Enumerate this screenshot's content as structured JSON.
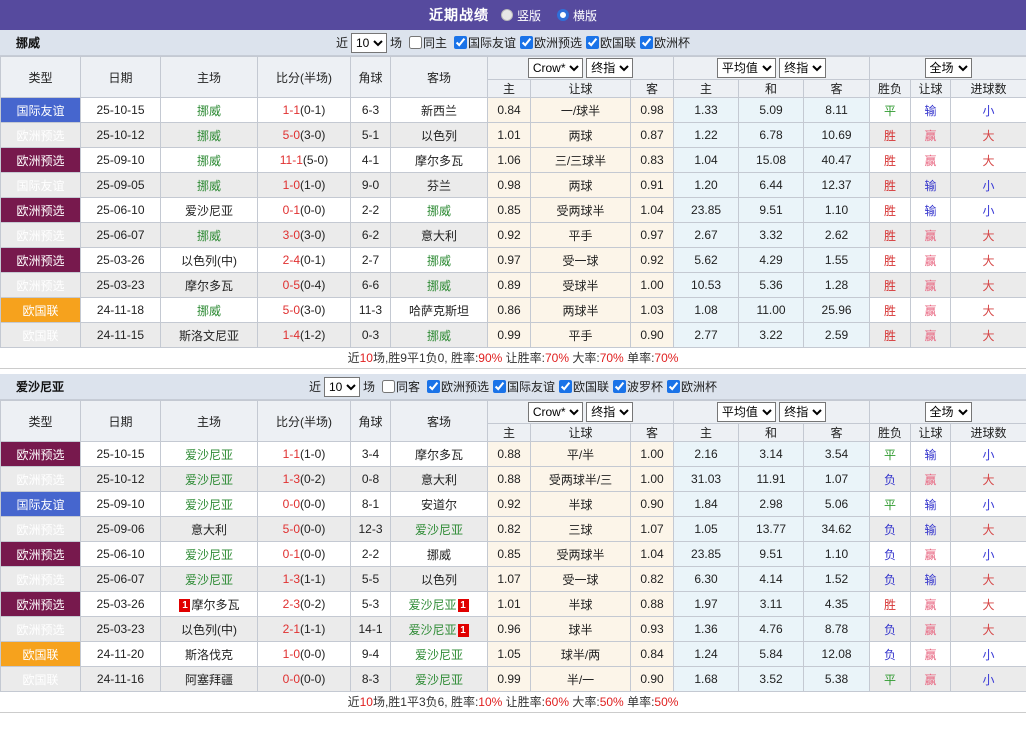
{
  "header": {
    "title": "近期战绩",
    "options": [
      {
        "label": "竖版",
        "selected": false
      },
      {
        "label": "横版",
        "selected": true
      }
    ]
  },
  "labels": {
    "near": "近",
    "count": "10",
    "games": "场"
  },
  "dropdowns": {
    "odds_source": "Crow*",
    "odds_final": "终指",
    "avg_source": "平均值",
    "avg_final": "终指",
    "result_scope": "全场"
  },
  "columns": {
    "type": "类型",
    "date": "日期",
    "home": "主场",
    "score": "比分(半场)",
    "corner": "角球",
    "away": "客场",
    "odds_home": "主",
    "handicap": "让球",
    "odds_away": "客",
    "avg_home": "主",
    "avg_draw": "和",
    "avg_away": "客",
    "wdl": "胜负",
    "handicap_result": "让球",
    "goals": "进球数"
  },
  "colors": {
    "header_bar": "#564A9E",
    "section_bar": "#DCE3ED",
    "badge_friendly": "#4666CE",
    "badge_qualifier": "#77194D",
    "badge_nations": "#F6A21D",
    "focus_team": "#2E8B35",
    "score_red": "#E03030",
    "win": "#D63333",
    "draw": "#2F9A2F",
    "lose": "#3333CC",
    "handicap_win": "#E8647F",
    "big": "#D64545",
    "small": "#3A3AD6",
    "odds_bg": "#FCF5E9",
    "avg_bg": "#EAF4F9",
    "row_alt": "#EBEBEB"
  },
  "sections": [
    {
      "team": "挪威",
      "same": "同主",
      "same_checked": false,
      "competitions": [
        "国际友谊",
        "欧洲预选",
        "欧国联",
        "欧洲杯"
      ],
      "rows": [
        {
          "type": "国际友谊",
          "date": "25-10-15",
          "home": "挪威",
          "hf": true,
          "hr": "",
          "score": "1-1",
          "half": "(0-1)",
          "corner": "6-3",
          "away": "新西兰",
          "af": false,
          "ar": "",
          "odds": [
            "0.84",
            "一/球半",
            "0.98"
          ],
          "avg": [
            "1.33",
            "5.09",
            "8.11"
          ],
          "res": [
            "平",
            "输",
            "小"
          ]
        },
        {
          "type": "欧洲预选",
          "date": "25-10-12",
          "home": "挪威",
          "hf": true,
          "hr": "",
          "score": "5-0",
          "half": "(3-0)",
          "corner": "5-1",
          "away": "以色列",
          "af": false,
          "ar": "",
          "odds": [
            "1.01",
            "两球",
            "0.87"
          ],
          "avg": [
            "1.22",
            "6.78",
            "10.69"
          ],
          "res": [
            "胜",
            "赢",
            "大"
          ]
        },
        {
          "type": "欧洲预选",
          "date": "25-09-10",
          "home": "挪威",
          "hf": true,
          "hr": "",
          "score": "11-1",
          "half": "(5-0)",
          "corner": "4-1",
          "away": "摩尔多瓦",
          "af": false,
          "ar": "",
          "odds": [
            "1.06",
            "三/三球半",
            "0.83"
          ],
          "avg": [
            "1.04",
            "15.08",
            "40.47"
          ],
          "res": [
            "胜",
            "赢",
            "大"
          ]
        },
        {
          "type": "国际友谊",
          "date": "25-09-05",
          "home": "挪威",
          "hf": true,
          "hr": "",
          "score": "1-0",
          "half": "(1-0)",
          "corner": "9-0",
          "away": "芬兰",
          "af": false,
          "ar": "",
          "odds": [
            "0.98",
            "两球",
            "0.91"
          ],
          "avg": [
            "1.20",
            "6.44",
            "12.37"
          ],
          "res": [
            "胜",
            "输",
            "小"
          ]
        },
        {
          "type": "欧洲预选",
          "date": "25-06-10",
          "home": "爱沙尼亚",
          "hf": false,
          "hr": "",
          "score": "0-1",
          "half": "(0-0)",
          "corner": "2-2",
          "away": "挪威",
          "af": true,
          "ar": "",
          "odds": [
            "0.85",
            "受两球半",
            "1.04"
          ],
          "avg": [
            "23.85",
            "9.51",
            "1.10"
          ],
          "res": [
            "胜",
            "输",
            "小"
          ]
        },
        {
          "type": "欧洲预选",
          "date": "25-06-07",
          "home": "挪威",
          "hf": true,
          "hr": "",
          "score": "3-0",
          "half": "(3-0)",
          "corner": "6-2",
          "away": "意大利",
          "af": false,
          "ar": "",
          "odds": [
            "0.92",
            "平手",
            "0.97"
          ],
          "avg": [
            "2.67",
            "3.32",
            "2.62"
          ],
          "res": [
            "胜",
            "赢",
            "大"
          ]
        },
        {
          "type": "欧洲预选",
          "date": "25-03-26",
          "home": "以色列(中)",
          "hf": false,
          "hr": "",
          "score": "2-4",
          "half": "(0-1)",
          "corner": "2-7",
          "away": "挪威",
          "af": true,
          "ar": "",
          "odds": [
            "0.97",
            "受一球",
            "0.92"
          ],
          "avg": [
            "5.62",
            "4.29",
            "1.55"
          ],
          "res": [
            "胜",
            "赢",
            "大"
          ]
        },
        {
          "type": "欧洲预选",
          "date": "25-03-23",
          "home": "摩尔多瓦",
          "hf": false,
          "hr": "",
          "score": "0-5",
          "half": "(0-4)",
          "corner": "6-6",
          "away": "挪威",
          "af": true,
          "ar": "",
          "odds": [
            "0.89",
            "受球半",
            "1.00"
          ],
          "avg": [
            "10.53",
            "5.36",
            "1.28"
          ],
          "res": [
            "胜",
            "赢",
            "大"
          ]
        },
        {
          "type": "欧国联",
          "date": "24-11-18",
          "home": "挪威",
          "hf": true,
          "hr": "",
          "score": "5-0",
          "half": "(3-0)",
          "corner": "11-3",
          "away": "哈萨克斯坦",
          "af": false,
          "ar": "",
          "odds": [
            "0.86",
            "两球半",
            "1.03"
          ],
          "avg": [
            "1.08",
            "11.00",
            "25.96"
          ],
          "res": [
            "胜",
            "赢",
            "大"
          ]
        },
        {
          "type": "欧国联",
          "date": "24-11-15",
          "home": "斯洛文尼亚",
          "hf": false,
          "hr": "",
          "score": "1-4",
          "half": "(1-2)",
          "corner": "0-3",
          "away": "挪威",
          "af": true,
          "ar": "",
          "odds": [
            "0.99",
            "平手",
            "0.90"
          ],
          "avg": [
            "2.77",
            "3.22",
            "2.59"
          ],
          "res": [
            "胜",
            "赢",
            "大"
          ]
        }
      ],
      "summary": [
        {
          "t": "近",
          "red": false
        },
        {
          "t": "10",
          "red": true
        },
        {
          "t": "场,胜9平1负0, 胜率:",
          "red": false
        },
        {
          "t": "90%",
          "red": true
        },
        {
          "t": " 让胜率:",
          "red": false
        },
        {
          "t": "70%",
          "red": true
        },
        {
          "t": " 大率:",
          "red": false
        },
        {
          "t": "70%",
          "red": true
        },
        {
          "t": " 单率:",
          "red": false
        },
        {
          "t": "70%",
          "red": true
        }
      ]
    },
    {
      "team": "爱沙尼亚",
      "same": "同客",
      "same_checked": false,
      "competitions": [
        "欧洲预选",
        "国际友谊",
        "欧国联",
        "波罗杯",
        "欧洲杯"
      ],
      "rows": [
        {
          "type": "欧洲预选",
          "date": "25-10-15",
          "home": "爱沙尼亚",
          "hf": true,
          "hr": "",
          "score": "1-1",
          "half": "(1-0)",
          "corner": "3-4",
          "away": "摩尔多瓦",
          "af": false,
          "ar": "",
          "odds": [
            "0.88",
            "平/半",
            "1.00"
          ],
          "avg": [
            "2.16",
            "3.14",
            "3.54"
          ],
          "res": [
            "平",
            "输",
            "小"
          ]
        },
        {
          "type": "欧洲预选",
          "date": "25-10-12",
          "home": "爱沙尼亚",
          "hf": true,
          "hr": "",
          "score": "1-3",
          "half": "(0-2)",
          "corner": "0-8",
          "away": "意大利",
          "af": false,
          "ar": "",
          "odds": [
            "0.88",
            "受两球半/三",
            "1.00"
          ],
          "avg": [
            "31.03",
            "11.91",
            "1.07"
          ],
          "res": [
            "负",
            "赢",
            "大"
          ]
        },
        {
          "type": "国际友谊",
          "date": "25-09-10",
          "home": "爱沙尼亚",
          "hf": true,
          "hr": "",
          "score": "0-0",
          "half": "(0-0)",
          "corner": "8-1",
          "away": "安道尔",
          "af": false,
          "ar": "",
          "odds": [
            "0.92",
            "半球",
            "0.90"
          ],
          "avg": [
            "1.84",
            "2.98",
            "5.06"
          ],
          "res": [
            "平",
            "输",
            "小"
          ]
        },
        {
          "type": "欧洲预选",
          "date": "25-09-06",
          "home": "意大利",
          "hf": false,
          "hr": "",
          "score": "5-0",
          "half": "(0-0)",
          "corner": "12-3",
          "away": "爱沙尼亚",
          "af": true,
          "ar": "",
          "odds": [
            "0.82",
            "三球",
            "1.07"
          ],
          "avg": [
            "1.05",
            "13.77",
            "34.62"
          ],
          "res": [
            "负",
            "输",
            "大"
          ]
        },
        {
          "type": "欧洲预选",
          "date": "25-06-10",
          "home": "爱沙尼亚",
          "hf": true,
          "hr": "",
          "score": "0-1",
          "half": "(0-0)",
          "corner": "2-2",
          "away": "挪威",
          "af": false,
          "ar": "",
          "odds": [
            "0.85",
            "受两球半",
            "1.04"
          ],
          "avg": [
            "23.85",
            "9.51",
            "1.10"
          ],
          "res": [
            "负",
            "赢",
            "小"
          ]
        },
        {
          "type": "欧洲预选",
          "date": "25-06-07",
          "home": "爱沙尼亚",
          "hf": true,
          "hr": "",
          "score": "1-3",
          "half": "(1-1)",
          "corner": "5-5",
          "away": "以色列",
          "af": false,
          "ar": "",
          "odds": [
            "1.07",
            "受一球",
            "0.82"
          ],
          "avg": [
            "6.30",
            "4.14",
            "1.52"
          ],
          "res": [
            "负",
            "输",
            "大"
          ]
        },
        {
          "type": "欧洲预选",
          "date": "25-03-26",
          "home": "摩尔多瓦",
          "hf": false,
          "hr": "1",
          "score": "2-3",
          "half": "(0-2)",
          "corner": "5-3",
          "away": "爱沙尼亚",
          "af": true,
          "ar": "1",
          "odds": [
            "1.01",
            "半球",
            "0.88"
          ],
          "avg": [
            "1.97",
            "3.11",
            "4.35"
          ],
          "res": [
            "胜",
            "赢",
            "大"
          ]
        },
        {
          "type": "欧洲预选",
          "date": "25-03-23",
          "home": "以色列(中)",
          "hf": false,
          "hr": "",
          "score": "2-1",
          "half": "(1-1)",
          "corner": "14-1",
          "away": "爱沙尼亚",
          "af": true,
          "ar": "1",
          "odds": [
            "0.96",
            "球半",
            "0.93"
          ],
          "avg": [
            "1.36",
            "4.76",
            "8.78"
          ],
          "res": [
            "负",
            "赢",
            "大"
          ]
        },
        {
          "type": "欧国联",
          "date": "24-11-20",
          "home": "斯洛伐克",
          "hf": false,
          "hr": "",
          "score": "1-0",
          "half": "(0-0)",
          "corner": "9-4",
          "away": "爱沙尼亚",
          "af": true,
          "ar": "",
          "odds": [
            "1.05",
            "球半/两",
            "0.84"
          ],
          "avg": [
            "1.24",
            "5.84",
            "12.08"
          ],
          "res": [
            "负",
            "赢",
            "小"
          ]
        },
        {
          "type": "欧国联",
          "date": "24-11-16",
          "home": "阿塞拜疆",
          "hf": false,
          "hr": "",
          "score": "0-0",
          "half": "(0-0)",
          "corner": "8-3",
          "away": "爱沙尼亚",
          "af": true,
          "ar": "",
          "odds": [
            "0.99",
            "半/一",
            "0.90"
          ],
          "avg": [
            "1.68",
            "3.52",
            "5.38"
          ],
          "res": [
            "平",
            "赢",
            "小"
          ]
        }
      ],
      "summary": [
        {
          "t": "近",
          "red": false
        },
        {
          "t": "10",
          "red": true
        },
        {
          "t": "场,胜1平3负6, 胜率:",
          "red": false
        },
        {
          "t": "10%",
          "red": true
        },
        {
          "t": " 让胜率:",
          "red": false
        },
        {
          "t": "60%",
          "red": true
        },
        {
          "t": " 大率:",
          "red": false
        },
        {
          "t": "50%",
          "red": true
        },
        {
          "t": " 单率:",
          "red": false
        },
        {
          "t": "50%",
          "red": true
        }
      ]
    }
  ]
}
